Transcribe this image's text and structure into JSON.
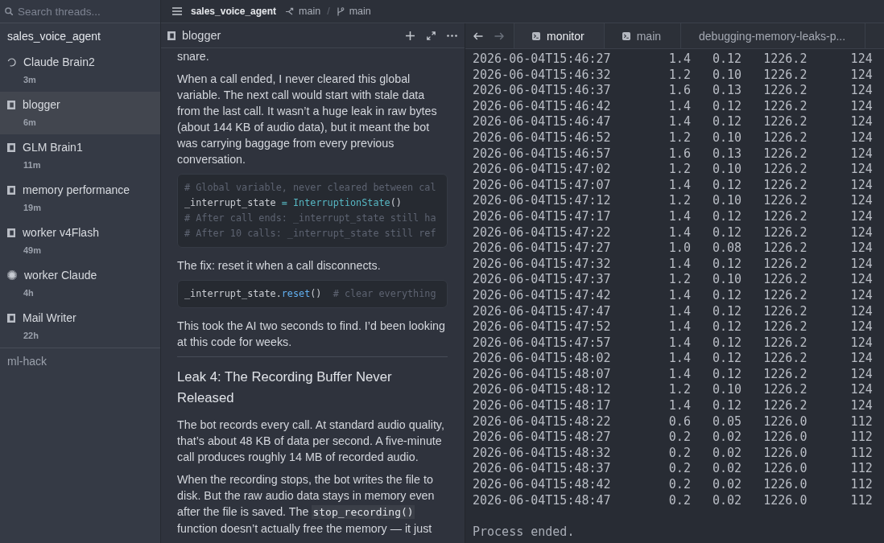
{
  "sidebar": {
    "search": {
      "placeholder": "Search threads..."
    },
    "groups": [
      {
        "name": "sales_voice_agent",
        "expanded": true,
        "threads": [
          {
            "title": "Claude Brain2",
            "age": "3m",
            "kind": "spinner",
            "selected": false
          },
          {
            "title": "blogger",
            "age": "6m",
            "kind": "square",
            "selected": true
          },
          {
            "title": "GLM Brain1",
            "age": "11m",
            "kind": "square",
            "selected": false
          },
          {
            "title": "memory performance",
            "age": "19m",
            "kind": "square",
            "selected": false
          },
          {
            "title": "worker v4Flash",
            "age": "49m",
            "kind": "square",
            "selected": false
          },
          {
            "title": "worker Claude",
            "age": "4h",
            "kind": "sparkle",
            "selected": false
          },
          {
            "title": "Mail Writer",
            "age": "22h",
            "kind": "square",
            "selected": false
          }
        ]
      },
      {
        "name": "ml-hack",
        "expanded": false
      }
    ]
  },
  "header": {
    "project": "sales_voice_agent",
    "branches": [
      {
        "kind": "fork",
        "name": "main"
      },
      {
        "kind": "branch",
        "name": "main"
      }
    ],
    "separator": "/"
  },
  "document_panel": {
    "title": "blogger",
    "blocks": [
      {
        "kind": "paragraph",
        "text": "snare."
      },
      {
        "kind": "paragraph",
        "text": "When a call ended, I never cleared this global variable. The next call would start with stale data from the last call. It wasn’t a huge leak in raw bytes (about 144 KB of audio data), but it meant the bot was carrying baggage from every previous conversation."
      },
      {
        "kind": "code",
        "lines": [
          [
            {
              "kind": "comment",
              "text": "# Global variable, never cleared between cal"
            }
          ],
          [
            {
              "kind": "plain",
              "text": "_interrupt_state "
            },
            {
              "kind": "operator",
              "text": "= "
            },
            {
              "kind": "class",
              "text": "InterruptionState"
            },
            {
              "kind": "plain",
              "text": "()"
            }
          ],
          [
            {
              "kind": "comment",
              "text": "# After call ends: _interrupt_state still ha"
            }
          ],
          [
            {
              "kind": "comment",
              "text": "# After 10 calls: _interrupt_state still ref"
            }
          ]
        ]
      },
      {
        "kind": "paragraph",
        "text": "The fix: reset it when a call disconnects."
      },
      {
        "kind": "code",
        "lines": [
          [
            {
              "kind": "plain",
              "text": "_interrupt_state."
            },
            {
              "kind": "method",
              "text": "reset"
            },
            {
              "kind": "plain",
              "text": "()  "
            },
            {
              "kind": "comment",
              "text": "# clear everything"
            }
          ]
        ]
      },
      {
        "kind": "paragraph",
        "text": "This took the AI two seconds to find. I’d been looking at this code for weeks."
      },
      {
        "kind": "rule"
      },
      {
        "kind": "heading",
        "text": "Leak 4: The Recording Buffer Never Released"
      },
      {
        "kind": "paragraph",
        "text": "The bot records every call. At standard audio quality, that’s about 48 KB of data per second. A five-minute call produces roughly 14 MB of recorded audio."
      },
      {
        "kind": "paragraph",
        "segments": [
          {
            "kind": "text",
            "text": "When the recording stops, the bot writes the file to disk. But the raw audio data stays in memory even after the file is saved. The "
          },
          {
            "kind": "code",
            "text": "stop_recording()"
          },
          {
            "kind": "text",
            "text": " function doesn’t actually free the memory — it just"
          }
        ]
      }
    ]
  },
  "terminal_panel": {
    "nav": [
      {
        "kind": "back",
        "disabled": false
      },
      {
        "kind": "forward",
        "disabled": true
      }
    ],
    "tabs": [
      {
        "label": "monitor",
        "kind": "terminal",
        "selected": true
      },
      {
        "label": "main",
        "kind": "terminal",
        "selected": false
      },
      {
        "label": "debugging-memory-leaks-p...",
        "kind": "plain",
        "selected": false
      }
    ],
    "lines": [
      "2026-06-04T15:46:27        1.4   0.12   1226.2      124",
      "2026-06-04T15:46:32        1.2   0.10   1226.2      124",
      "2026-06-04T15:46:37        1.6   0.13   1226.2      124",
      "2026-06-04T15:46:42        1.4   0.12   1226.2      124",
      "2026-06-04T15:46:47        1.4   0.12   1226.2      124",
      "2026-06-04T15:46:52        1.2   0.10   1226.2      124",
      "2026-06-04T15:46:57        1.6   0.13   1226.2      124",
      "2026-06-04T15:47:02        1.2   0.10   1226.2      124",
      "2026-06-04T15:47:07        1.4   0.12   1226.2      124",
      "2026-06-04T15:47:12        1.2   0.10   1226.2      124",
      "2026-06-04T15:47:17        1.4   0.12   1226.2      124",
      "2026-06-04T15:47:22        1.4   0.12   1226.2      124",
      "2026-06-04T15:47:27        1.0   0.08   1226.2      124",
      "2026-06-04T15:47:32        1.4   0.12   1226.2      124",
      "2026-06-04T15:47:37        1.2   0.10   1226.2      124",
      "2026-06-04T15:47:42        1.4   0.12   1226.2      124",
      "2026-06-04T15:47:47        1.4   0.12   1226.2      124",
      "2026-06-04T15:47:52        1.4   0.12   1226.2      124",
      "2026-06-04T15:47:57        1.4   0.12   1226.2      124",
      "2026-06-04T15:48:02        1.4   0.12   1226.2      124",
      "2026-06-04T15:48:07        1.4   0.12   1226.2      124",
      "2026-06-04T15:48:12        1.2   0.10   1226.2      124",
      "2026-06-04T15:48:17        1.4   0.12   1226.2      124",
      "2026-06-04T15:48:22        0.6   0.05   1226.0      112",
      "2026-06-04T15:48:27        0.2   0.02   1226.0      112",
      "2026-06-04T15:48:32        0.2   0.02   1226.0      112",
      "2026-06-04T15:48:37        0.2   0.02   1226.0      112",
      "2026-06-04T15:48:42        0.2   0.02   1226.0      112",
      "2026-06-04T15:48:47        0.2   0.02   1226.0      112"
    ],
    "status": "Process ended."
  }
}
